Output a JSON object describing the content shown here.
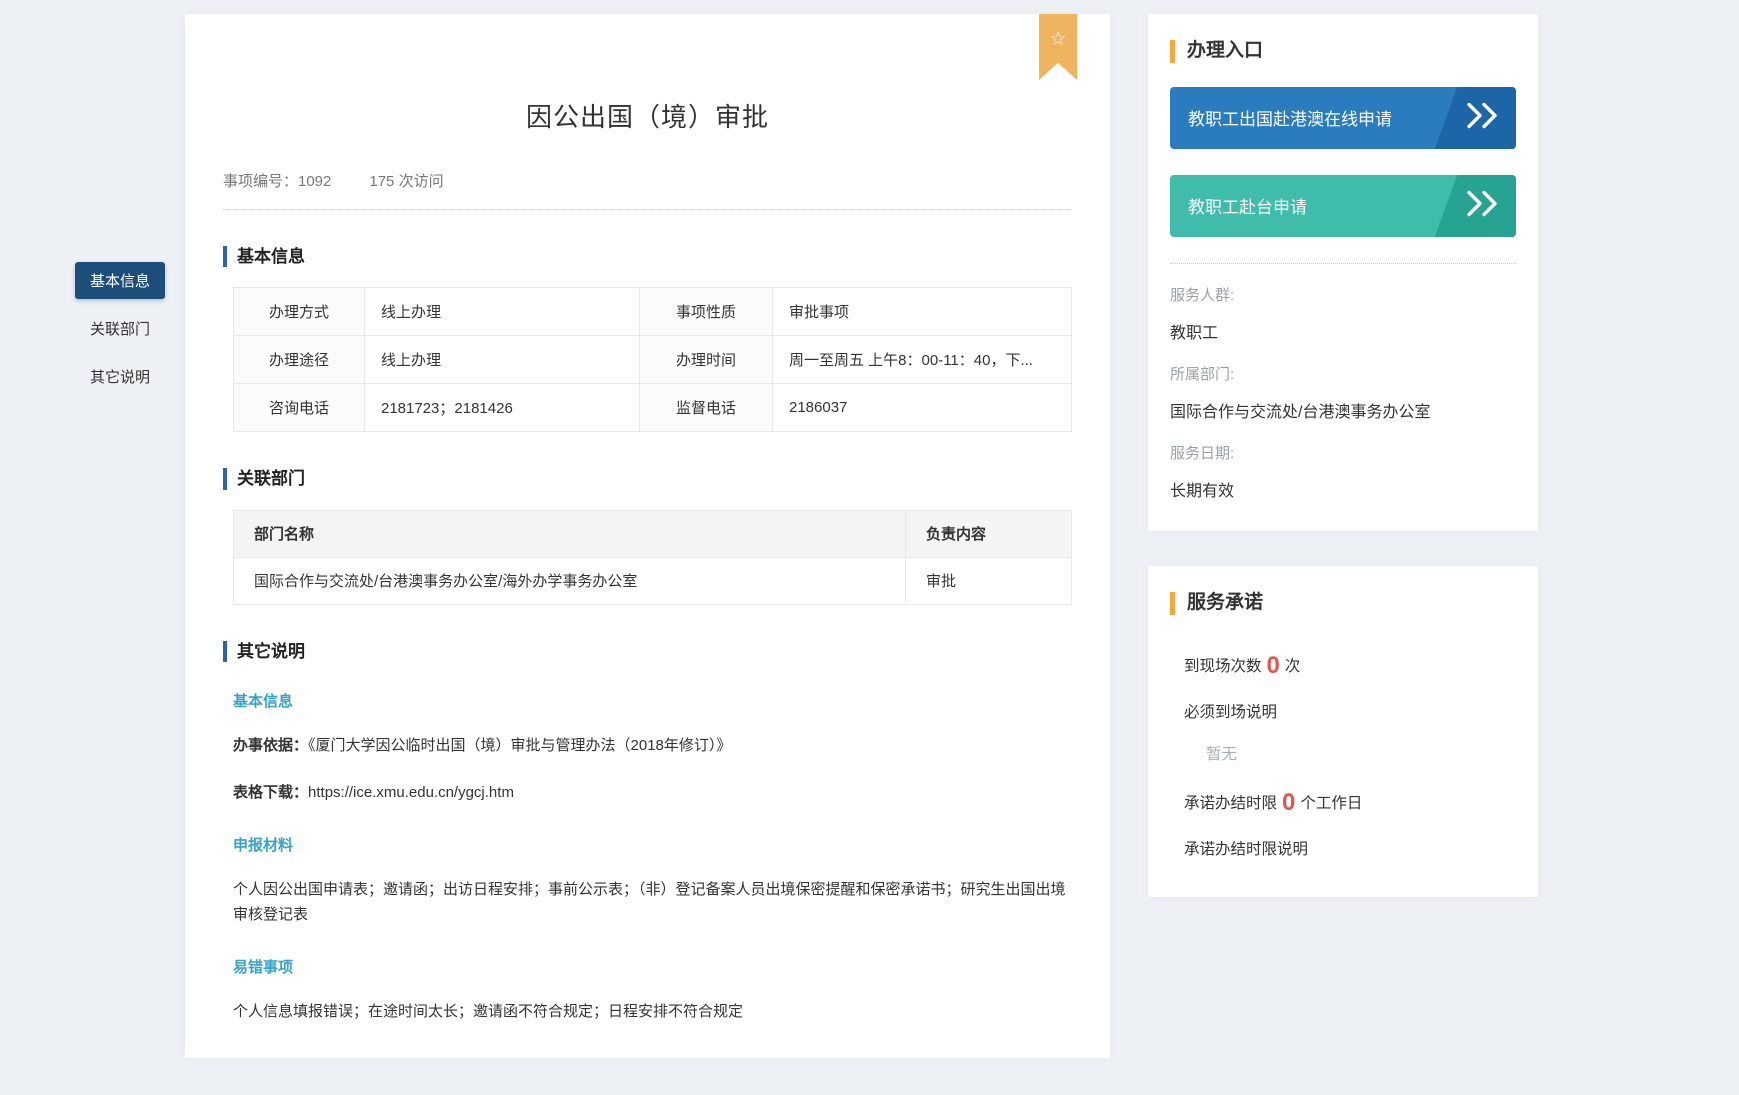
{
  "sidebar": {
    "items": [
      {
        "label": "基本信息",
        "active": true
      },
      {
        "label": "关联部门",
        "active": false
      },
      {
        "label": "其它说明",
        "active": false
      }
    ]
  },
  "main": {
    "title": "因公出国（境）审批",
    "item_no": "事项编号：1092",
    "visits": "175 次访问",
    "basic_info": {
      "heading": "基本信息",
      "rows": [
        {
          "l1": "办理方式",
          "v1": "线上办理",
          "l2": "事项性质",
          "v2": "审批事项"
        },
        {
          "l1": "办理途径",
          "v1": "线上办理",
          "l2": "办理时间",
          "v2": "周一至周五 上午8：00-11：40，下..."
        },
        {
          "l1": "咨询电话",
          "v1": "2181723；2181426",
          "l2": "监督电话",
          "v2": "2186037"
        }
      ]
    },
    "related": {
      "heading": "关联部门",
      "col1": "部门名称",
      "col2": "负责内容",
      "rows": [
        {
          "dept": "国际合作与交流处/台港澳事务办公室/海外办学事务办公室",
          "duty": "审批"
        }
      ]
    },
    "other": {
      "heading": "其它说明",
      "sub1": "基本信息",
      "basis_label": "办事依据：",
      "basis_text": "《厦门大学因公临时出国（境）审批与管理办法（2018年修订）》",
      "download_label": "表格下载：",
      "download_text": "https://ice.xmu.edu.cn/ygcj.htm",
      "sub2": "申报材料",
      "materials_text": "个人因公出国申请表；邀请函；出访日程安排；事前公示表；（非）登记备案人员出境保密提醒和保密承诺书；研究生出国出境审核登记表",
      "sub3": "易错事项",
      "errors_text": "个人信息填报错误；在途时间太长；邀请函不符合规定；日程安排不符合规定"
    }
  },
  "entry": {
    "heading": "办理入口",
    "buttons": [
      {
        "label": "教职工出国赴港澳在线申请",
        "color": "#2a7cbf",
        "band_color": "#1c66a8"
      },
      {
        "label": "教职工赴台申请",
        "color": "#3fbcaa",
        "band_color": "#27a392"
      }
    ],
    "info": [
      {
        "label": "服务人群:",
        "value": "教职工"
      },
      {
        "label": "所属部门:",
        "value": "国际合作与交流处/台港澳事务办公室"
      },
      {
        "label": "服务日期:",
        "value": "长期有效"
      }
    ]
  },
  "promise": {
    "heading": "服务承诺",
    "onsite_prefix": "到现场次数",
    "onsite_count": "0",
    "onsite_suffix": "次",
    "onsite_note_label": "必须到场说明",
    "onsite_note_value": "暂无",
    "deadline_prefix": "承诺办结时限",
    "deadline_count": "0",
    "deadline_suffix": "个工作日",
    "deadline_note_label": "承诺办结时限说明",
    "colors": {
      "accent_red": "#e2574c",
      "accent_orange": "#f5a73b",
      "nav_active": "#1d4e79",
      "section_bar": "#2866a8"
    }
  }
}
